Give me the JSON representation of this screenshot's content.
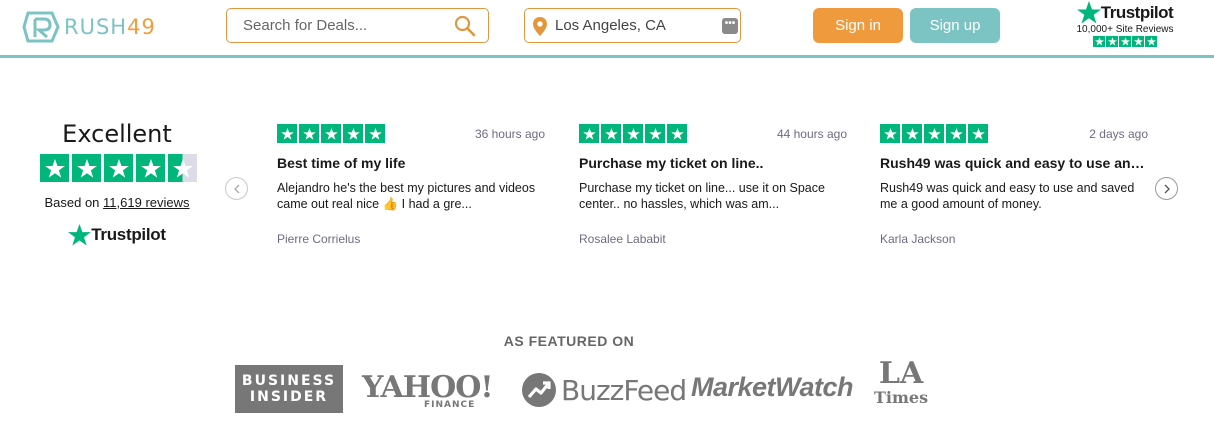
{
  "header": {
    "logo": {
      "part1": "RUSH",
      "part2": "49"
    },
    "search": {
      "placeholder": "Search for Deals..."
    },
    "location": {
      "value": "Los Angeles, CA"
    },
    "signin_label": "Sign in",
    "signup_label": "Sign up",
    "trustpilot": {
      "brand": "Trustpilot",
      "subtitle": "10,000+ Site Reviews"
    }
  },
  "summary": {
    "rating_label": "Excellent",
    "rating_stars": 4.5,
    "based_on": "Based on",
    "review_count": "11,619 reviews",
    "brand": "Trustpilot"
  },
  "reviews": [
    {
      "stars": 5,
      "time": "36 hours ago",
      "title": "Best time of my life",
      "body": "Alejandro he's the best my pictures and videos came out real nice 👍 I had a gre...",
      "author": "Pierre Corrielus"
    },
    {
      "stars": 5,
      "time": "44 hours ago",
      "title": "Purchase my ticket on line..",
      "body": "Purchase my ticket on line... use it on Space center.. no hassles, which was am...",
      "author": "Rosalee Lababit"
    },
    {
      "stars": 5,
      "time": "2 days ago",
      "title": "Rush49 was quick and easy to use an…",
      "body": "Rush49 was quick and easy to use and saved me a good amount of money.",
      "author": "Karla Jackson"
    }
  ],
  "featured": {
    "heading": "AS FEATURED ON",
    "business_insider": [
      "BUSINESS",
      "INSIDER"
    ],
    "yahoo": "YAHOO!",
    "yahoo_sub": "FINANCE",
    "buzzfeed": "BuzzFeed",
    "marketwatch": "MarketWatch",
    "latimes": [
      "LA",
      "Times"
    ]
  },
  "colors": {
    "accent_orange": "#f09a3e",
    "accent_teal": "#7cc3c3",
    "trustpilot_green": "#00b67a"
  }
}
